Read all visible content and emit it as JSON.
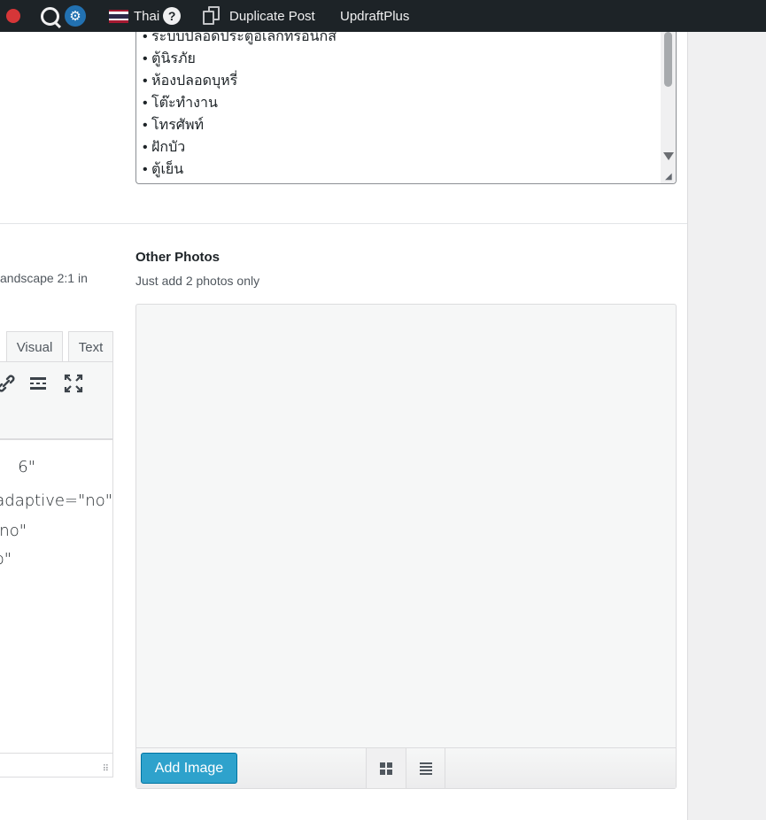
{
  "admin_bar": {
    "language": "Thai",
    "help": "?",
    "duplicate_post": "Duplicate Post",
    "updraftplus": "UpdraftPlus"
  },
  "amenities": {
    "items": [
      "ระบบปลอดประตูอิเล็กทรอนิกส์",
      "ตู้นิรภัย",
      "ห้องปลอดบุหรี่",
      "โต๊ะทำงาน",
      "โทรศัพท์",
      "ฝักบัว",
      "ตู้เย็น",
      "…"
    ]
  },
  "left_column": {
    "description_fragment": "andscape 2:1 in",
    "tab_visual": "Visual",
    "tab_text": "Text",
    "code_lines": [
      "6\"",
      "adaptive=\"no\"",
      "no\"",
      "o\""
    ]
  },
  "other_photos": {
    "title": "Other Photos",
    "help": "Just add 2 photos only",
    "add_image": "Add Image"
  },
  "colors": {
    "admin_bar": "#1d2327",
    "accent_button": "#2ea2cc"
  }
}
